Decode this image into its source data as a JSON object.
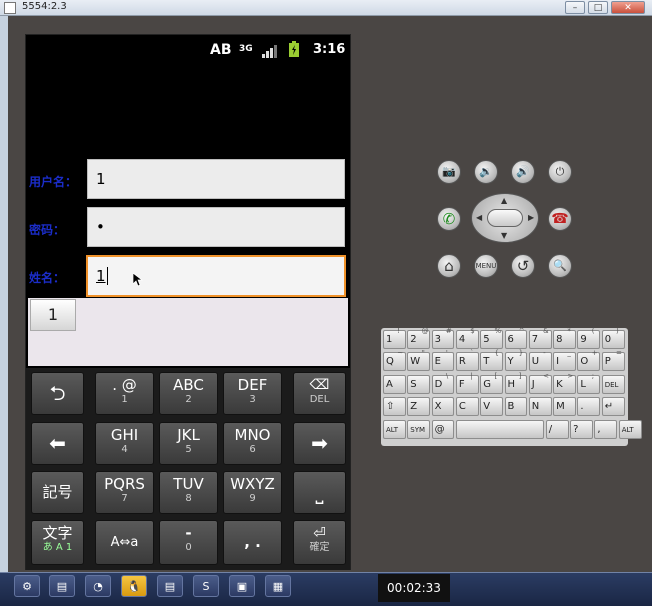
{
  "window": {
    "title": "5554:2.3",
    "buttons": [
      "–",
      "□",
      "✕"
    ]
  },
  "status_bar": {
    "ime": "AB",
    "network": "3G",
    "time": "3:16"
  },
  "form": {
    "username": {
      "label": "用户名：",
      "value": "1"
    },
    "password": {
      "label": "密码：",
      "value": "•"
    },
    "name": {
      "label": "姓名：",
      "value": "1"
    }
  },
  "candidate": {
    "item": "1"
  },
  "keypad": {
    "back_glyph": "⮌",
    "left_glyph": "⬅",
    "right_glyph": "➡",
    "del_glyph": "⌫",
    "del_label": "DEL",
    "symbols_label": "記号",
    "space_glyph": "⎵",
    "moji_label": "文字",
    "moji_sub": "あ A 1",
    "convert_label": "A⇔a",
    "enter_glyph": "⏎",
    "enter_label": "確定",
    "k1_main": ". @",
    "k1_sub": "1",
    "k2_main": "ABC",
    "k2_sub": "2",
    "k3_main": "DEF",
    "k3_sub": "3",
    "k4_main": "GHI",
    "k4_sub": "4",
    "k5_main": "JKL",
    "k5_sub": "5",
    "k6_main": "MNO",
    "k6_sub": "6",
    "k7_main": "PQRS",
    "k7_sub": "7",
    "k8_main": "TUV",
    "k8_sub": "8",
    "k9_main": "WXYZ",
    "k9_sub": "9",
    "k0_main": "-",
    "k0_sub": "0",
    "kpunct_main": ", ."
  },
  "hardware": {
    "camera": "📷",
    "vol_down": "🔉",
    "vol_up": "🔊",
    "power": "⏻",
    "call": "✆",
    "end_call": "☎",
    "home": "⌂",
    "menu": "MENU",
    "back": "↺",
    "search": "🔍",
    "arrow_up": "▲",
    "arrow_down": "▼",
    "arrow_left": "◀",
    "arrow_right": "▶"
  },
  "qwerty_rows": [
    [
      "1",
      "2",
      "3",
      "4",
      "5",
      "6",
      "7",
      "8",
      "9",
      "0"
    ],
    [
      "Q",
      "W",
      "E",
      "R",
      "T",
      "Y",
      "U",
      "I",
      "O",
      "P"
    ],
    [
      "A",
      "S",
      "D",
      "F",
      "G",
      "H",
      "J",
      "K",
      "L",
      "DEL"
    ],
    [
      "⇧",
      "Z",
      "X",
      "C",
      "V",
      "B",
      "N",
      "M",
      ".",
      "↵"
    ],
    [
      "ALT",
      "SYM",
      "@",
      "",
      "",
      "/",
      "?",
      ",",
      "ALT"
    ]
  ],
  "qwerty_alt": [
    [
      "!",
      "@",
      "#",
      "$",
      "%",
      "^",
      "&",
      "*",
      "(",
      ")"
    ],
    [
      "~",
      "\"",
      "'",
      "`",
      "{",
      "}",
      "-",
      "_",
      "+",
      "="
    ],
    [
      "",
      "",
      "\\",
      "|",
      "[",
      "]",
      "<",
      ">",
      ";",
      ""
    ]
  ],
  "taskbar": {
    "timer": "00:02:33",
    "items": [
      "⚙",
      "▤",
      "◔",
      "🐧",
      "▤",
      "S",
      "▣",
      "▦"
    ]
  },
  "colors": {
    "accent_focus": "#f0922a",
    "label_blue": "#1b2dc9"
  }
}
